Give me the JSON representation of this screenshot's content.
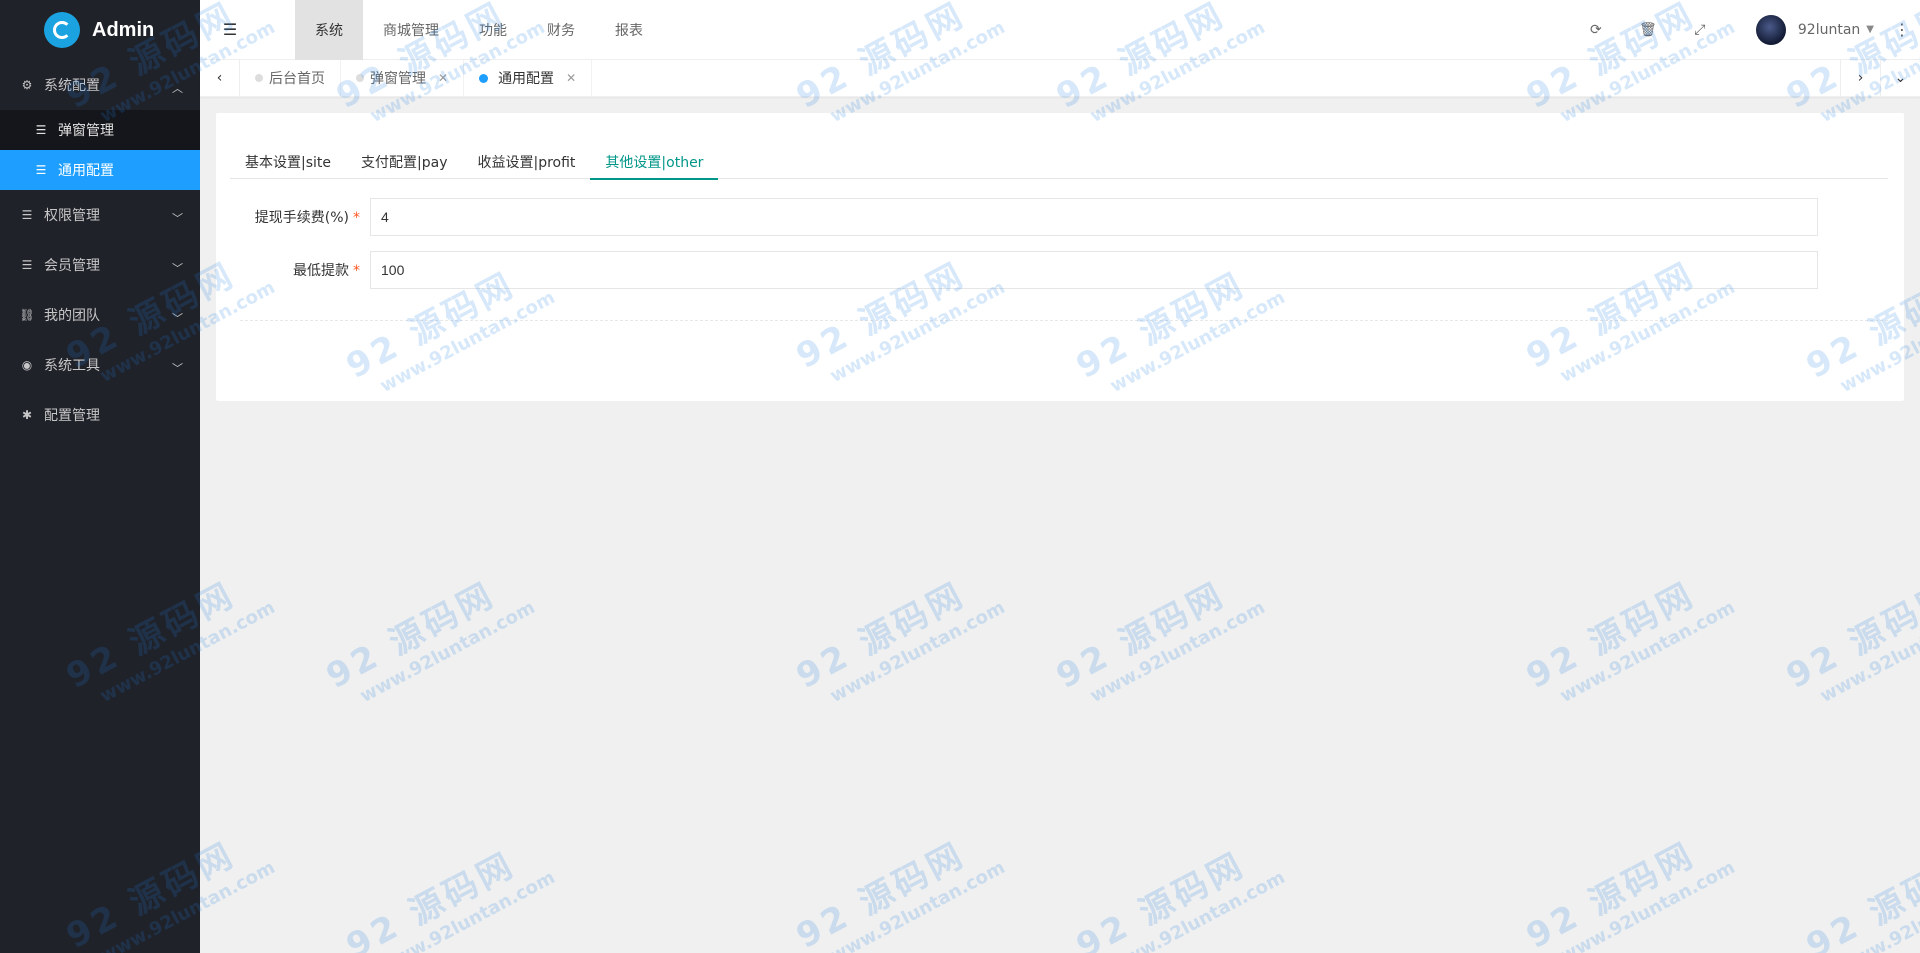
{
  "sidebar": {
    "logo_text": "Admin",
    "items": [
      {
        "label": "系统配置",
        "expanded": true,
        "children": [
          {
            "label": "弹窗管理",
            "active": false
          },
          {
            "label": "通用配置",
            "active": true
          }
        ]
      },
      {
        "label": "权限管理"
      },
      {
        "label": "会员管理"
      },
      {
        "label": "我的团队"
      },
      {
        "label": "系统工具"
      },
      {
        "label": "配置管理"
      }
    ]
  },
  "header": {
    "top_menu": [
      "系统",
      "商城管理",
      "功能",
      "财务",
      "报表"
    ],
    "active_menu": "系统",
    "username": "92luntan"
  },
  "tabs": [
    {
      "label": "后台首页",
      "closable": false,
      "active": false
    },
    {
      "label": "弹窗管理",
      "closable": true,
      "active": false
    },
    {
      "label": "通用配置",
      "closable": true,
      "active": true
    }
  ],
  "form_tabs": [
    {
      "label": "基本设置|site",
      "active": false
    },
    {
      "label": "支付配置|pay",
      "active": false
    },
    {
      "label": "收益设置|profit",
      "active": false
    },
    {
      "label": "其他设置|other",
      "active": true
    }
  ],
  "fields": [
    {
      "label": "提现手续费(%)",
      "required": true,
      "value": "4"
    },
    {
      "label": "最低提款",
      "required": true,
      "value": "100"
    }
  ],
  "watermark": {
    "big": "92 源码网",
    "small": "www.92luntan.com"
  },
  "colors": {
    "sidebar_bg": "#20222a",
    "active_blue": "#1e9fff",
    "tab_green": "#009688"
  }
}
